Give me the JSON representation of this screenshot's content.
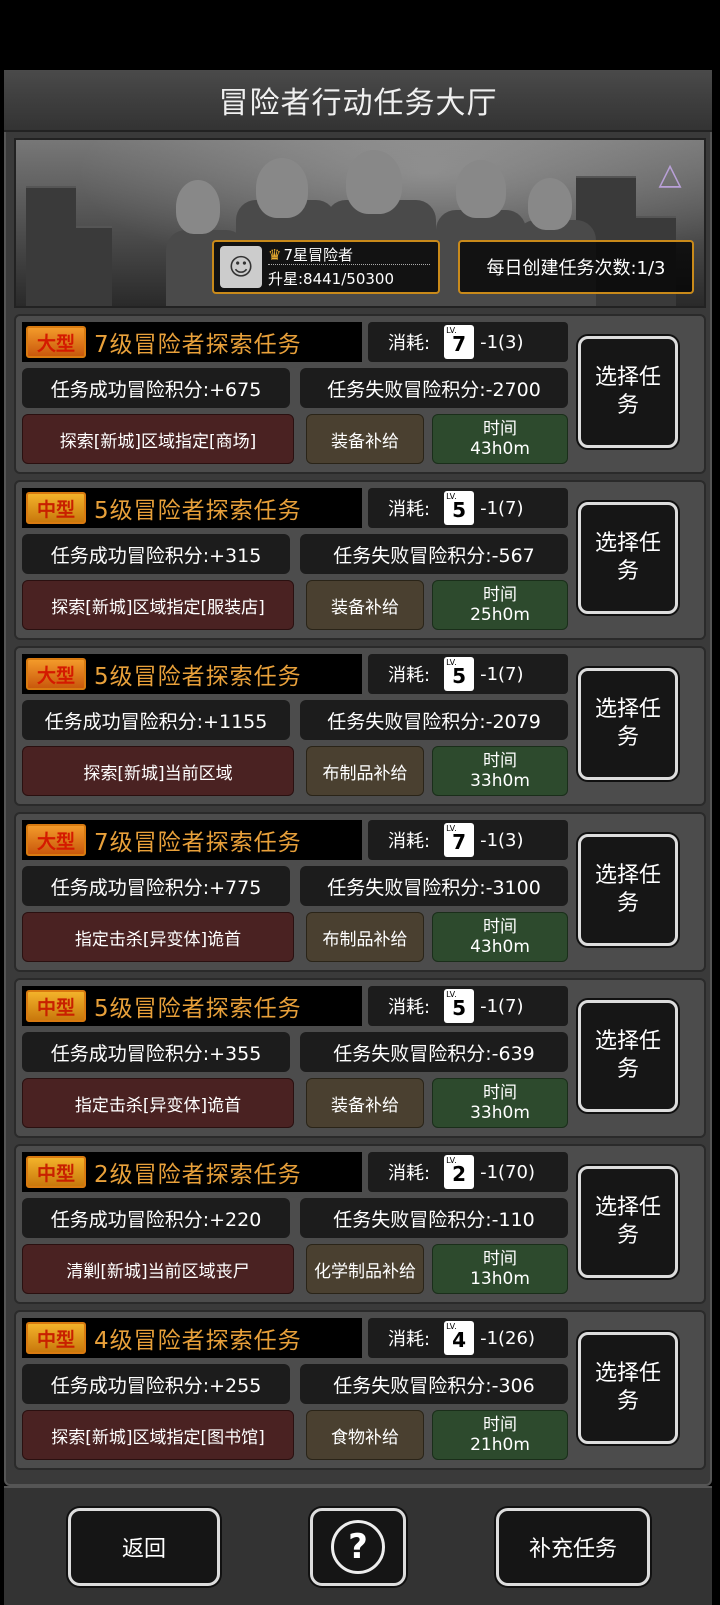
{
  "header": {
    "title": "冒险者行动任务大厅"
  },
  "rank": {
    "name": "7星冒险者",
    "exp": "升星:8441/50300",
    "medal_icon": "medal-icon"
  },
  "daily": {
    "text": "每日创建任务次数:1/3"
  },
  "tasks": [
    {
      "size": "大型",
      "name": "7级冒险者探索任务",
      "cost_label": "消耗:",
      "lv": "7",
      "cost": "-1(3)",
      "win": "任务成功冒险积分:+675",
      "lose": "任务失败冒险积分:-2700",
      "target": "探索[新城]区域指定[商场]",
      "supply": "装备补给",
      "time_label": "时间",
      "time": "43h0m",
      "select": "选择任务"
    },
    {
      "size": "中型",
      "name": "5级冒险者探索任务",
      "cost_label": "消耗:",
      "lv": "5",
      "cost": "-1(7)",
      "win": "任务成功冒险积分:+315",
      "lose": "任务失败冒险积分:-567",
      "target": "探索[新城]区域指定[服装店]",
      "supply": "装备补给",
      "time_label": "时间",
      "time": "25h0m",
      "select": "选择任务"
    },
    {
      "size": "大型",
      "name": "5级冒险者探索任务",
      "cost_label": "消耗:",
      "lv": "5",
      "cost": "-1(7)",
      "win": "任务成功冒险积分:+1155",
      "lose": "任务失败冒险积分:-2079",
      "target": "探索[新城]当前区域",
      "supply": "布制品补给",
      "time_label": "时间",
      "time": "33h0m",
      "select": "选择任务"
    },
    {
      "size": "大型",
      "name": "7级冒险者探索任务",
      "cost_label": "消耗:",
      "lv": "7",
      "cost": "-1(3)",
      "win": "任务成功冒险积分:+775",
      "lose": "任务失败冒险积分:-3100",
      "target": "指定击杀[异变体]诡首",
      "supply": "布制品补给",
      "time_label": "时间",
      "time": "43h0m",
      "select": "选择任务"
    },
    {
      "size": "中型",
      "name": "5级冒险者探索任务",
      "cost_label": "消耗:",
      "lv": "5",
      "cost": "-1(7)",
      "win": "任务成功冒险积分:+355",
      "lose": "任务失败冒险积分:-639",
      "target": "指定击杀[异变体]诡首",
      "supply": "装备补给",
      "time_label": "时间",
      "time": "33h0m",
      "select": "选择任务"
    },
    {
      "size": "中型",
      "name": "2级冒险者探索任务",
      "cost_label": "消耗:",
      "lv": "2",
      "cost": "-1(70)",
      "win": "任务成功冒险积分:+220",
      "lose": "任务失败冒险积分:-110",
      "target": "清剿[新城]当前区域丧尸",
      "supply": "化学制品补给",
      "time_label": "时间",
      "time": "13h0m",
      "select": "选择任务"
    },
    {
      "size": "中型",
      "name": "4级冒险者探索任务",
      "cost_label": "消耗:",
      "lv": "4",
      "cost": "-1(26)",
      "win": "任务成功冒险积分:+255",
      "lose": "任务失败冒险积分:-306",
      "target": "探索[新城]区域指定[图书馆]",
      "supply": "食物补给",
      "time_label": "时间",
      "time": "21h0m",
      "select": "选择任务"
    }
  ],
  "footer": {
    "back": "返回",
    "help_icon": "help-map-icon",
    "help_glyph": "?",
    "refill": "补充任务"
  }
}
